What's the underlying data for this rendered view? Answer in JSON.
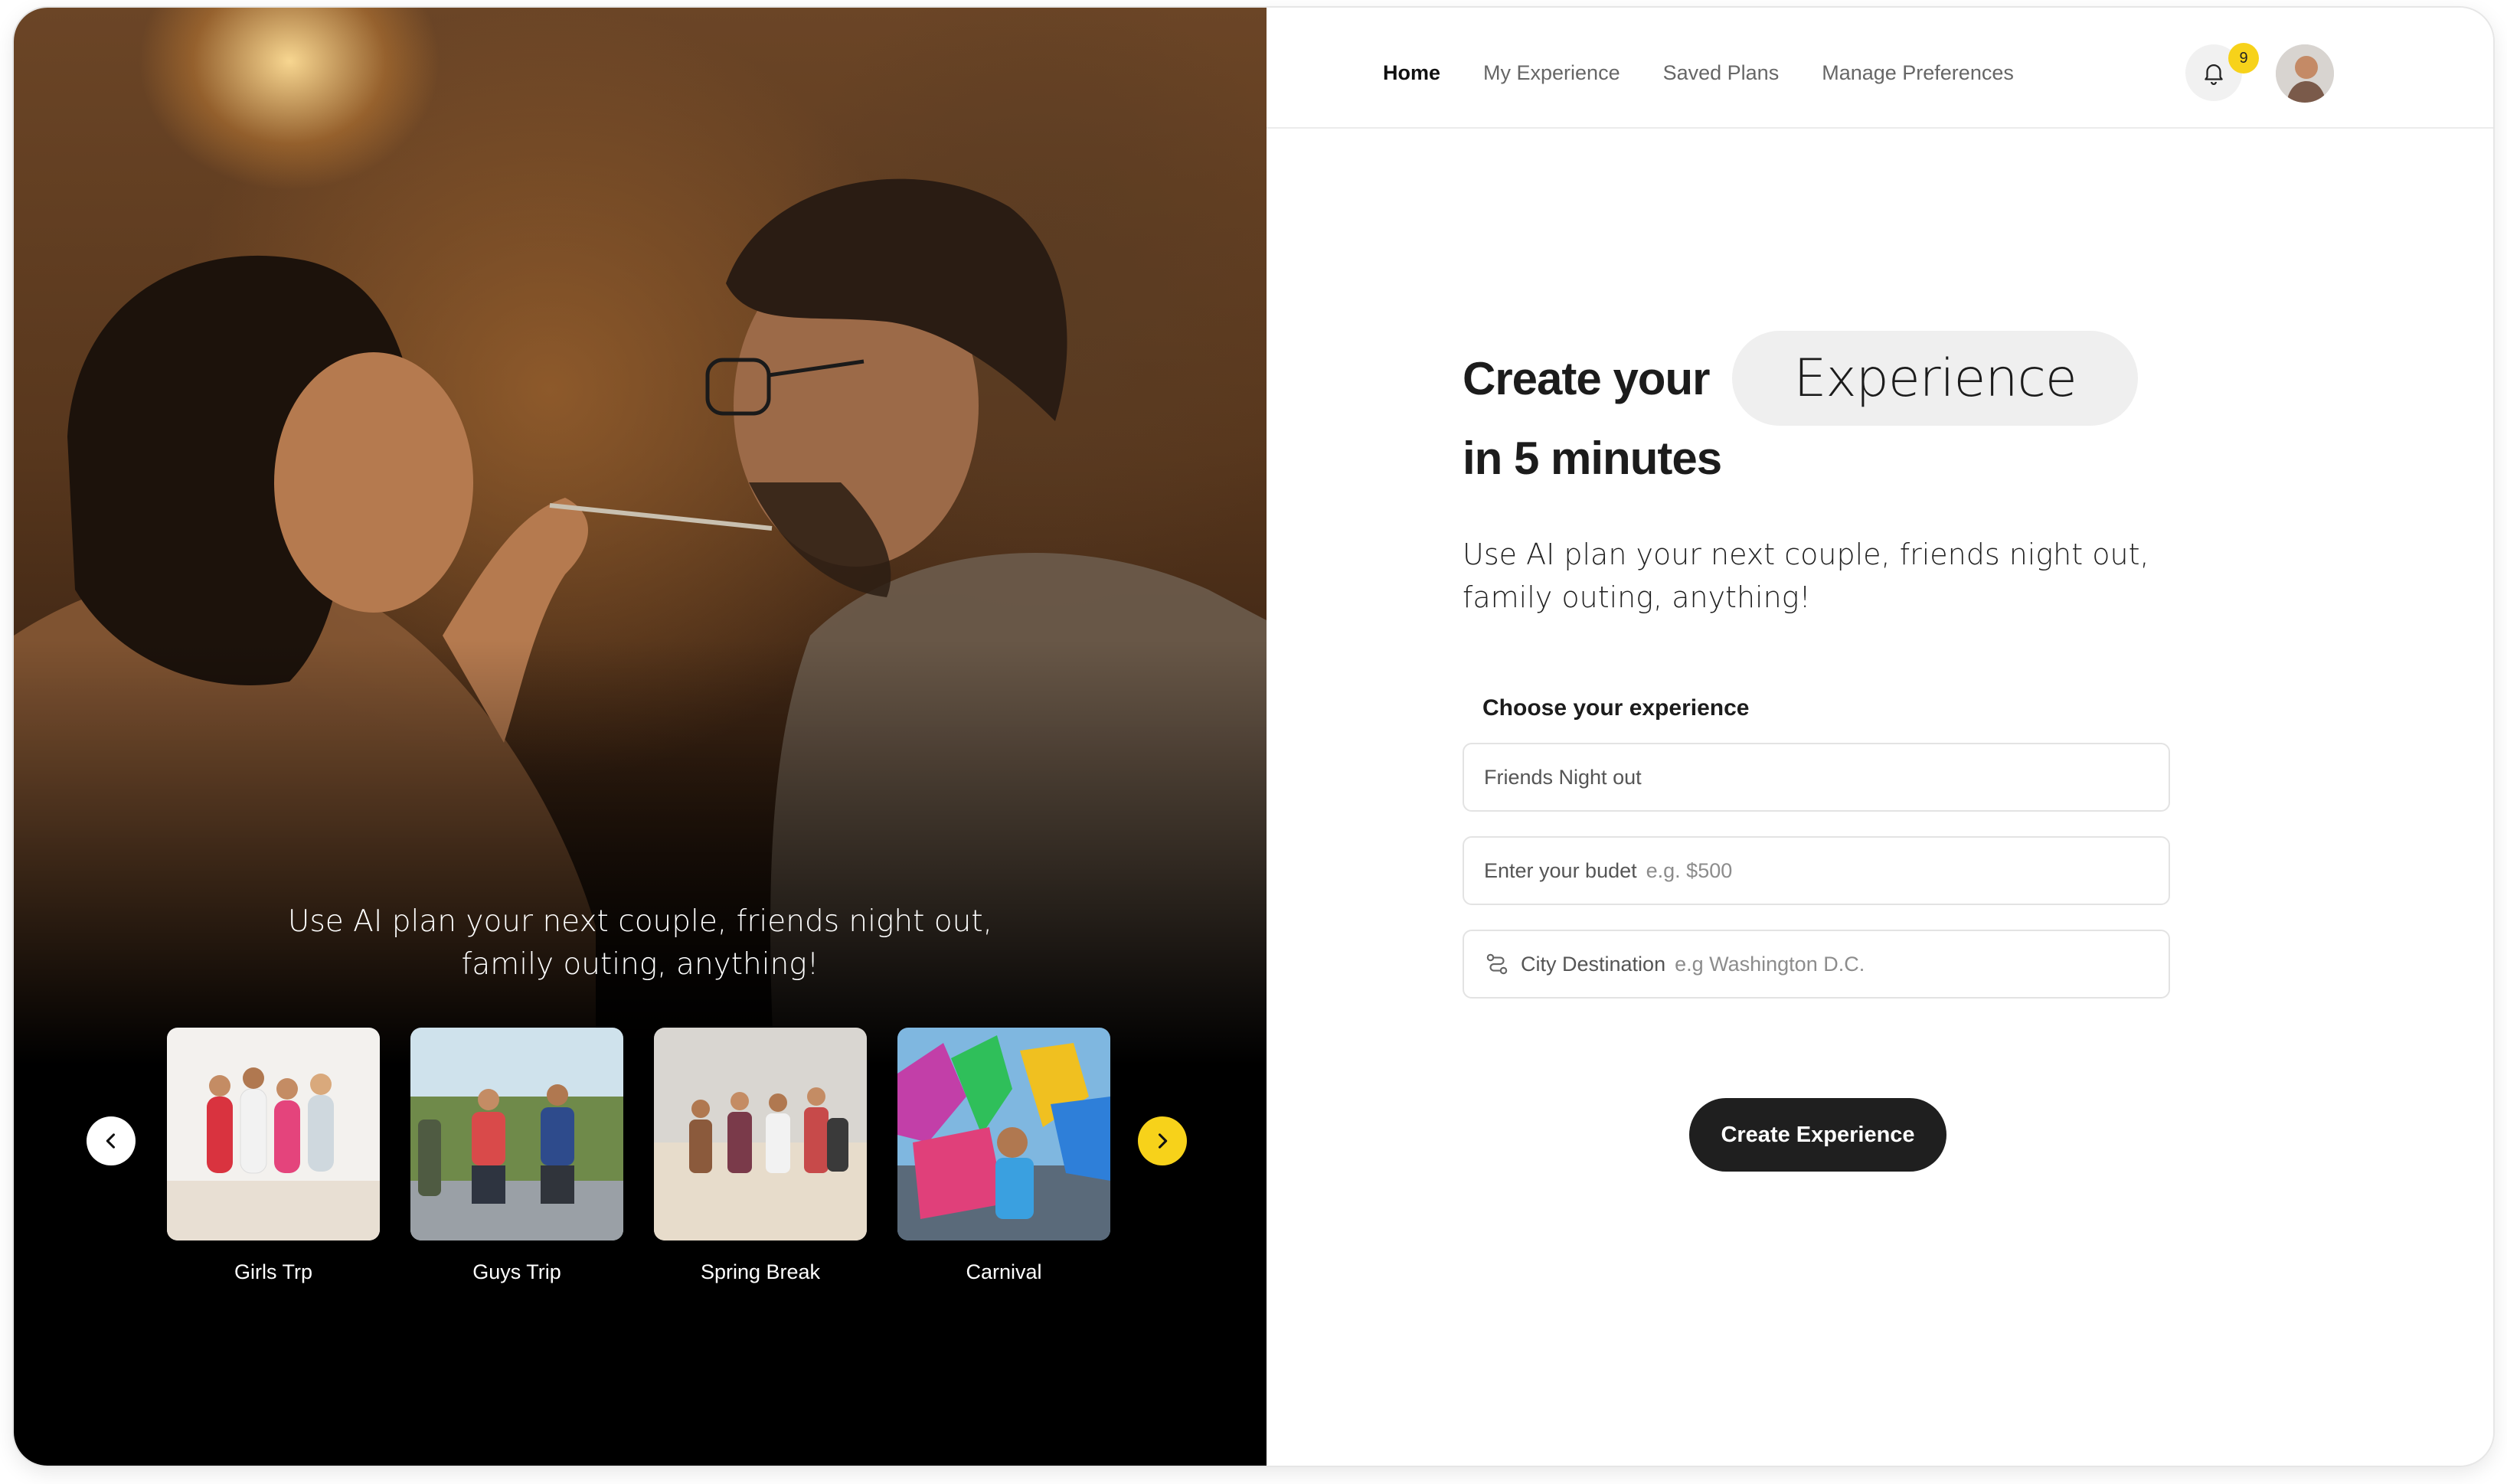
{
  "colors": {
    "accent": "#f7d21a",
    "cta_bg": "#1f1f1f",
    "hero_bg": "#000000"
  },
  "hero": {
    "caption_line1": "Use AI plan your next couple, friends night out,",
    "caption_line2": "family outing, anything!",
    "prev_icon": "chevron-left-icon",
    "next_icon": "chevron-right-icon",
    "cards": [
      {
        "label": "Girls Trp"
      },
      {
        "label": "Guys Trip"
      },
      {
        "label": "Spring Break"
      },
      {
        "label": "Carnival"
      }
    ]
  },
  "nav": {
    "links": [
      {
        "label": "Home",
        "active": true
      },
      {
        "label": "My Experience"
      },
      {
        "label": "Saved Plans"
      },
      {
        "label": "Manage Preferences"
      }
    ],
    "notification_icon": "bell-icon",
    "notification_count": "9"
  },
  "main": {
    "headline_part1": "Create your",
    "headline_pill": "Experience",
    "headline_part2": "in 5 minutes",
    "subtitle_line1": "Use AI plan your next couple, friends night out,",
    "subtitle_line2": "family outing, anything!",
    "section_label": "Choose your experience",
    "fields": {
      "experience_value": "Friends Night out",
      "budget_label": "Enter your budet",
      "budget_placeholder": "e.g. $500",
      "city_label": "City Destination",
      "city_placeholder": "e.g Washington D.C.",
      "city_icon": "route-icon"
    },
    "cta_label": "Create Experience"
  }
}
